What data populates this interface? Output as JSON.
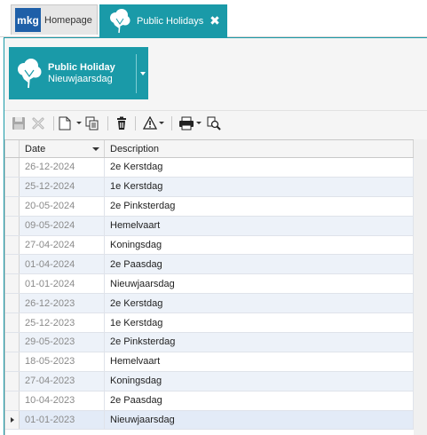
{
  "tabs": {
    "home": {
      "logo": "mkg",
      "label": "Homepage"
    },
    "active": {
      "label": "Public Holidays",
      "close": "✖",
      "icon": "tree-icon"
    }
  },
  "record": {
    "title": "Public Holiday",
    "subtitle": "Nieuwjaarsdag",
    "icon": "tree-icon"
  },
  "toolbar": {
    "buttons": [
      "save-icon",
      "discard-icon",
      "new-document-icon",
      "copy-icon",
      "delete-icon",
      "warning-icon",
      "print-icon",
      "preview-icon"
    ]
  },
  "grid": {
    "columns": {
      "date": "Date",
      "description": "Description"
    },
    "rows": [
      {
        "date": "26-12-2024",
        "description": "2e Kerstdag"
      },
      {
        "date": "25-12-2024",
        "description": "1e Kerstdag"
      },
      {
        "date": "20-05-2024",
        "description": "2e Pinksterdag"
      },
      {
        "date": "09-05-2024",
        "description": "Hemelvaart"
      },
      {
        "date": "27-04-2024",
        "description": "Koningsdag"
      },
      {
        "date": "01-04-2024",
        "description": "2e Paasdag"
      },
      {
        "date": "01-01-2024",
        "description": "Nieuwjaarsdag"
      },
      {
        "date": "26-12-2023",
        "description": "2e Kerstdag"
      },
      {
        "date": "25-12-2023",
        "description": "1e Kerstdag"
      },
      {
        "date": "29-05-2023",
        "description": "2e Pinksterdag"
      },
      {
        "date": "18-05-2023",
        "description": "Hemelvaart"
      },
      {
        "date": "27-04-2023",
        "description": "Koningsdag"
      },
      {
        "date": "10-04-2023",
        "description": "2e Paasdag"
      },
      {
        "date": "01-01-2023",
        "description": "Nieuwjaarsdag"
      }
    ],
    "selected_index": 13
  },
  "colors": {
    "accent": "#1a9aa8",
    "brand": "#1e5fa8",
    "row_alt": "#edf2f9",
    "row_selected": "#e3ebf7"
  }
}
